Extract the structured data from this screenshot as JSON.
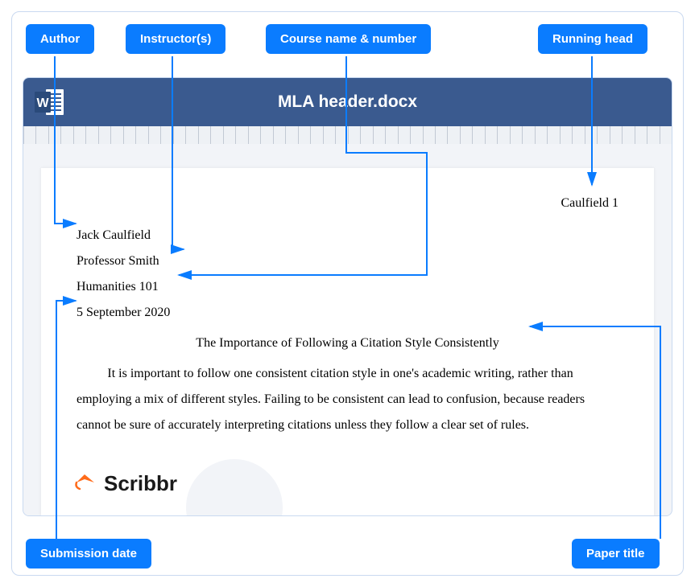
{
  "tags": {
    "author": "Author",
    "instructor": "Instructor(s)",
    "course": "Course name & number",
    "running_head": "Running head",
    "submission": "Submission date",
    "paper_title": "Paper title"
  },
  "window": {
    "filename": "MLA header.docx"
  },
  "paper": {
    "running_head": "Caulfield 1",
    "author": "Jack Caulfield",
    "instructor": "Professor Smith",
    "course": "Humanities 101",
    "date": "5 September 2020",
    "title": "The Importance of Following a Citation Style Consistently",
    "body": "It is important to follow one consistent citation style in one's academic writing, rather than employing a mix of different styles. Failing to be consistent can lead to confusion, because readers cannot be sure of accurately interpreting citations unless they follow a clear set of rules."
  },
  "brand": {
    "name": "Scribbr"
  },
  "colors": {
    "tag": "#0a7cff",
    "titlebar": "#3a5a8f",
    "brand_accent": "#ff6b1a"
  }
}
